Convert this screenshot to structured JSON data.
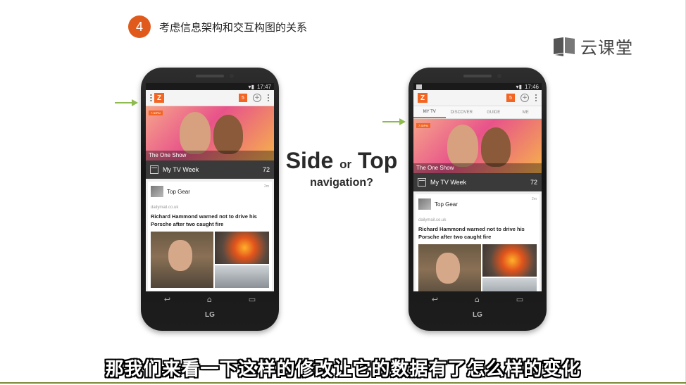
{
  "header": {
    "step_number": "4",
    "title": "考虑信息架构和交互构图的关系"
  },
  "logo": {
    "text": "云课堂",
    "icon": "book-icon"
  },
  "question": {
    "word1": "Side",
    "word_or": "or",
    "word2": "Top",
    "line2": "navigation?"
  },
  "colors": {
    "accent": "#f26522",
    "badge": "#e05a1c",
    "arrow": "#8dbb4e"
  },
  "phone_left": {
    "time": "17:47",
    "notification_count": "5",
    "hero_tag": "7:30PM",
    "hero_caption": "The One Show",
    "week_label": "My TV Week",
    "week_count": "72",
    "card_title": "Top Gear",
    "card_time": "2m",
    "card_source": "dailymail.co.uk",
    "card_headline_1": "Richard Hammond warned not to drive his",
    "card_headline_2": "Porsche after two caught fire",
    "brand": "LG"
  },
  "phone_right": {
    "time": "17:46",
    "notification_count": "5",
    "tabs": [
      "MY TV",
      "DISCOVER",
      "GUIDE",
      "ME"
    ],
    "hero_tag": "7:30PM",
    "hero_caption": "The One Show",
    "week_label": "My TV Week",
    "week_count": "72",
    "card_title": "Top Gear",
    "card_time": "2m",
    "card_source": "dailymail.co.uk",
    "card_headline_1": "Richard Hammond warned not to drive his",
    "card_headline_2": "Porsche after two caught fire",
    "brand": "LG"
  },
  "subtitle": "那我们来看一下这样的修改让它的数据有了怎么样的变化"
}
